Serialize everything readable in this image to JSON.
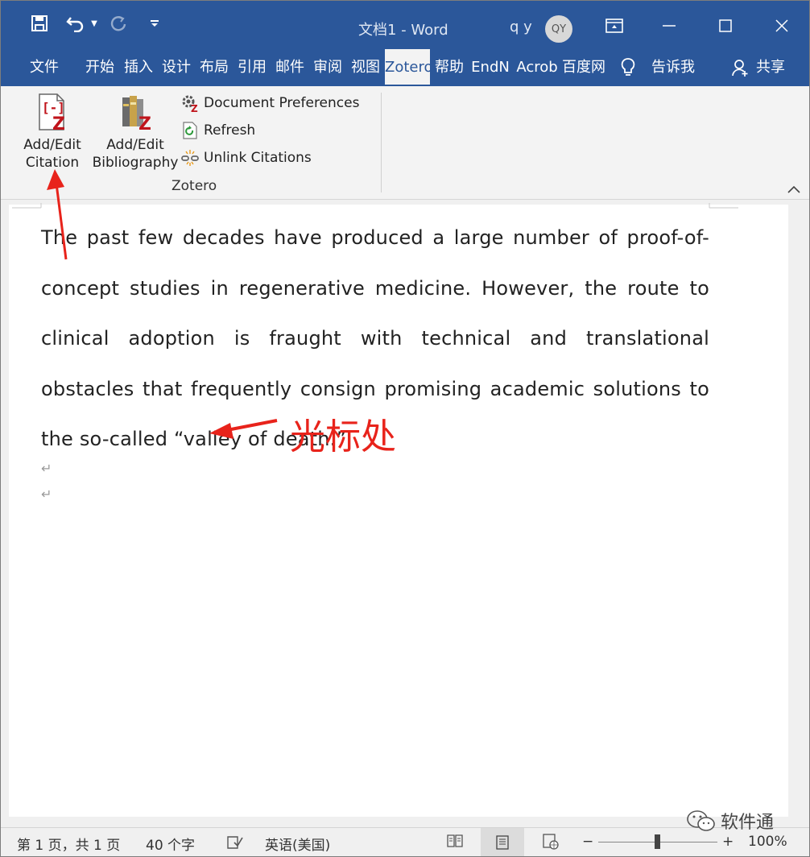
{
  "title_bar": {
    "doc_title": "文档1  -  Word",
    "user_name": "q y",
    "avatar_initials": "QY"
  },
  "tabs": [
    {
      "label": "文件"
    },
    {
      "label": "开始"
    },
    {
      "label": "插入"
    },
    {
      "label": "设计"
    },
    {
      "label": "布局"
    },
    {
      "label": "引用"
    },
    {
      "label": "邮件"
    },
    {
      "label": "审阅"
    },
    {
      "label": "视图"
    },
    {
      "label": "Zotero",
      "active": true
    },
    {
      "label": "帮助"
    },
    {
      "label": "EndN"
    },
    {
      "label": "Acrob"
    },
    {
      "label": "百度网"
    },
    {
      "label": "告诉我"
    },
    {
      "label": "共享"
    }
  ],
  "ribbon": {
    "add_citation_line1": "Add/Edit",
    "add_citation_line2": "Citation",
    "add_bibliography_line1": "Add/Edit",
    "add_bibliography_line2": "Bibliography",
    "document_preferences": "Document Preferences",
    "refresh": "Refresh",
    "unlink_citations": "Unlink Citations",
    "group_label": "Zotero"
  },
  "document": {
    "paragraph": "The past few decades have produced a large number of proof-of-concept studies in regenerative medicine. However, the route to clinical adoption is fraught with technical and translational obstacles that frequently consign promising academic solutions to the so-called “valley of death.”",
    "pilcrow": "↵"
  },
  "annotation": {
    "cursor_label": "光标处",
    "color": "#e8231b"
  },
  "status_bar": {
    "page": "第 1 页，共 1 页",
    "word_count": "40 个字",
    "language": "英语(美国)",
    "zoom_minus": "−",
    "zoom_plus": "+",
    "zoom": "100%"
  },
  "watermark": "软件通",
  "colors": {
    "title_bar": "#2b579a",
    "ribbon": "#f3f3f3"
  }
}
